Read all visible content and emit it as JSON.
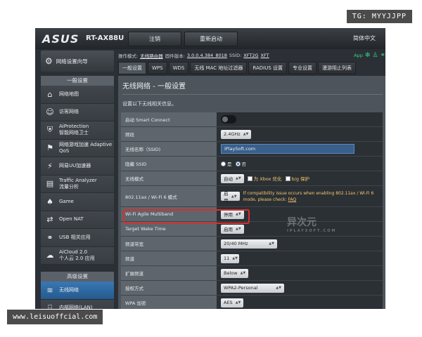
{
  "overlay": {
    "top_right_tag": "TG: MYYJJPP",
    "bottom_left_tag": "www.leisuoffcial.com"
  },
  "header": {
    "brand": "ASUS",
    "model": "RT-AX88U",
    "logout_label": "注销",
    "reboot_label": "重新启动",
    "language": "简体中文"
  },
  "status_bar": {
    "mode_label": "操作模式:",
    "mode_value": "无线路由器",
    "firmware_label": "固件版本:",
    "firmware_value": "3.0.0.4.384_8018",
    "ssid_label": "SSID:",
    "ssid_1": "XFT2G",
    "ssid_2": "XFT",
    "app_label": "App"
  },
  "sidebar": {
    "wizard_label": "网络设置向导",
    "general_header": "一般设置",
    "general_items": [
      {
        "label": "网络地图",
        "icon": "network-map-icon"
      },
      {
        "label": "访客网络",
        "icon": "guest-network-icon"
      },
      {
        "label": "AiProtection\n智能网络卫士",
        "icon": "aiprotection-icon"
      },
      {
        "label": "网络游戏加速 Adaptive\nQoS",
        "icon": "adaptive-qos-icon"
      },
      {
        "label": "网易UU加速器",
        "icon": "uu-accelerator-icon"
      },
      {
        "label": "Traffic Analyzer\n流量分析",
        "icon": "traffic-analyzer-icon"
      },
      {
        "label": "Game",
        "icon": "game-icon"
      },
      {
        "label": "Open NAT",
        "icon": "open-nat-icon"
      },
      {
        "label": "USB 相关应用",
        "icon": "usb-icon"
      },
      {
        "label": "AiCloud 2.0\n个人云 2.0 应用",
        "icon": "aicloud-icon"
      }
    ],
    "advanced_header": "高级设置",
    "advanced_items": [
      {
        "label": "无线网络",
        "icon": "wireless-icon"
      },
      {
        "label": "内部网络(LAN)",
        "icon": "lan-icon"
      }
    ]
  },
  "tabs": [
    "一般设置",
    "WPS",
    "WDS",
    "无线 MAC 地址过滤器",
    "RADIUS 设置",
    "专业设置",
    "漫游阻止列表"
  ],
  "panel": {
    "title": "无线网络 - 一般设置",
    "description": "设置以下无线相关信息。",
    "rows": {
      "smart_connect": {
        "label": "启动 Smart Connect"
      },
      "band": {
        "label": "频段",
        "value": "2.4GHz"
      },
      "ssid": {
        "label": "无线名称（SSID)",
        "value": "iPlaySoft.com"
      },
      "hide_ssid": {
        "label": "隐藏 SSID",
        "yes": "是",
        "no": "否",
        "selected": "否"
      },
      "wireless_mode": {
        "label": "无线模式",
        "value": "自动",
        "xbox": "为 Xbox 优化",
        "bg": "b/g 保护"
      },
      "wifi6_mode": {
        "label": "802.11ax / Wi-Fi 6 模式",
        "value": "启用",
        "warning": "If compatibility issue occurs when enabling 802.11ax / Wi-Fi 6 mode, please check:",
        "faq": "FAQ"
      },
      "agile_multiband": {
        "label": "Wi-Fi Agile Multiband",
        "value": "停用"
      },
      "target_wake_time": {
        "label": "Target Wake Time",
        "value": "启用"
      },
      "bandwidth": {
        "label": "频道带宽",
        "value": "20/40 MHz"
      },
      "channel": {
        "label": "频道",
        "value": "11"
      },
      "ext_channel": {
        "label": "扩展频道",
        "value": "Below"
      },
      "auth_method": {
        "label": "授权方式",
        "value": "WPA2-Personal"
      },
      "wpa_encryption": {
        "label": "WPA 加密",
        "value": "AES"
      }
    }
  },
  "watermark": {
    "text": "异次元",
    "sub": "IPLAYSOFT.COM"
  },
  "colors": {
    "highlight": "#d72f2f",
    "accent_green": "#33d17a",
    "warning": "#f5c86b"
  }
}
